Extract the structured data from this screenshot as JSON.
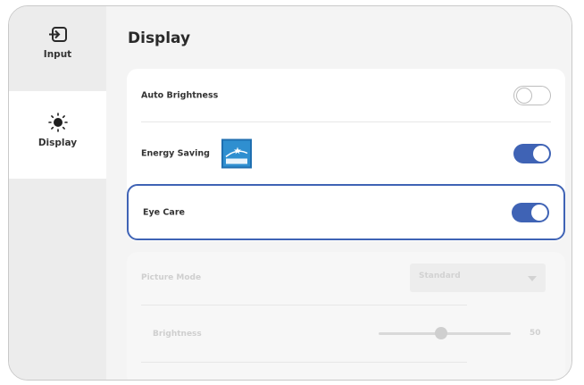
{
  "sidebar": {
    "items": [
      {
        "label": "Input",
        "icon": "input-icon"
      },
      {
        "label": "Display",
        "icon": "sun-icon"
      }
    ]
  },
  "main": {
    "title": "Display",
    "settings": {
      "auto_brightness": {
        "label": "Auto Brightness",
        "enabled": false
      },
      "energy_saving": {
        "label": "Energy Saving",
        "enabled": true,
        "logo": "energy-star-logo"
      },
      "eye_care": {
        "label": "Eye Care",
        "enabled": true
      }
    },
    "picture_mode": {
      "label": "Picture Mode",
      "value": "Standard"
    },
    "brightness": {
      "label": "Brightness",
      "value": "50",
      "level": 0.5
    }
  },
  "colors": {
    "accent": "#3f63b5",
    "toggle_off_border": "#bdbdbd",
    "energy_logo": "#2f8fd0"
  }
}
